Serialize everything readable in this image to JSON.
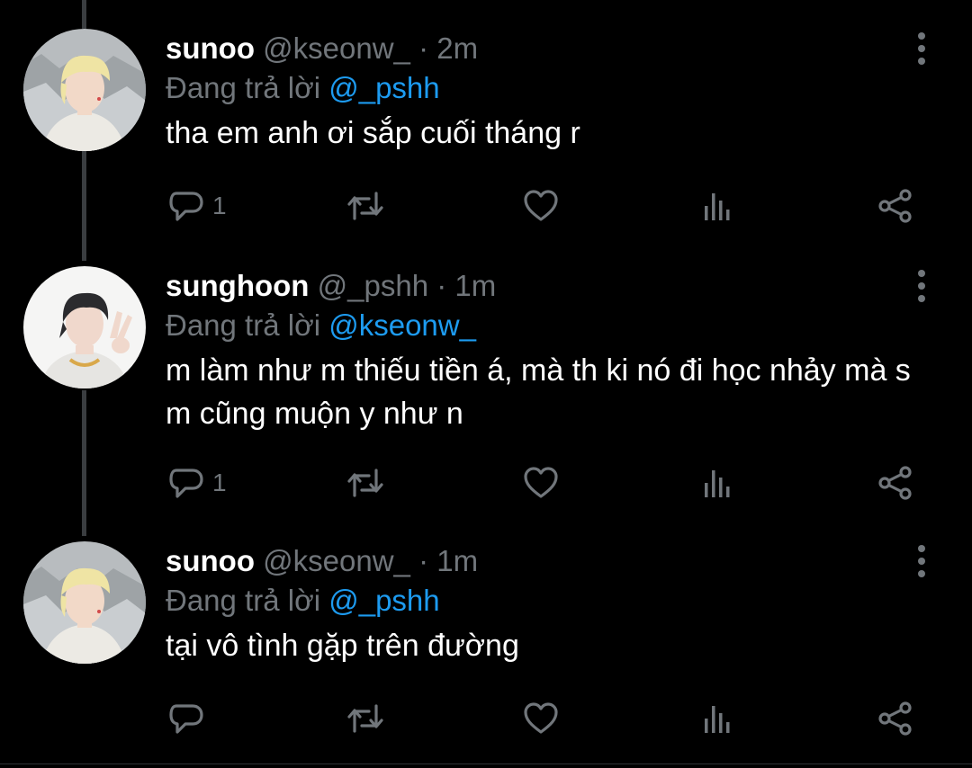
{
  "tweets": [
    {
      "name": "sunoo",
      "handle": "@kseonw_",
      "separator": "·",
      "time": "2m",
      "replying_prefix": "Đang trả lời",
      "replying_to": "@_pshh",
      "text": "tha em anh ơi sắp cuối tháng r",
      "reply_count": "1",
      "avatar": "blonde-person-avatar"
    },
    {
      "name": "sunghoon",
      "handle": "@_pshh",
      "separator": "·",
      "time": "1m",
      "replying_prefix": "Đang trả lời",
      "replying_to": "@kseonw_",
      "text": "m làm như m thiếu tiền á, mà th ki nó đi học nhảy mà s m cũng muộn y như n",
      "reply_count": "1",
      "avatar": "dark-hair-peace-sign-avatar"
    },
    {
      "name": "sunoo",
      "handle": "@kseonw_",
      "separator": "·",
      "time": "1m",
      "replying_prefix": "Đang trả lời",
      "replying_to": "@_pshh",
      "text": "tại vô tình gặp trên đường",
      "reply_count": "",
      "avatar": "blonde-person-avatar"
    }
  ],
  "icons": [
    "reply-icon",
    "retweet-icon",
    "like-icon",
    "analytics-icon",
    "share-icon",
    "more-options-icon"
  ],
  "colors": {
    "background": "#000000",
    "text": "#ffffff",
    "secondary": "#71767b",
    "mention": "#1d9bf0",
    "thread_line": "#3a3d40"
  }
}
